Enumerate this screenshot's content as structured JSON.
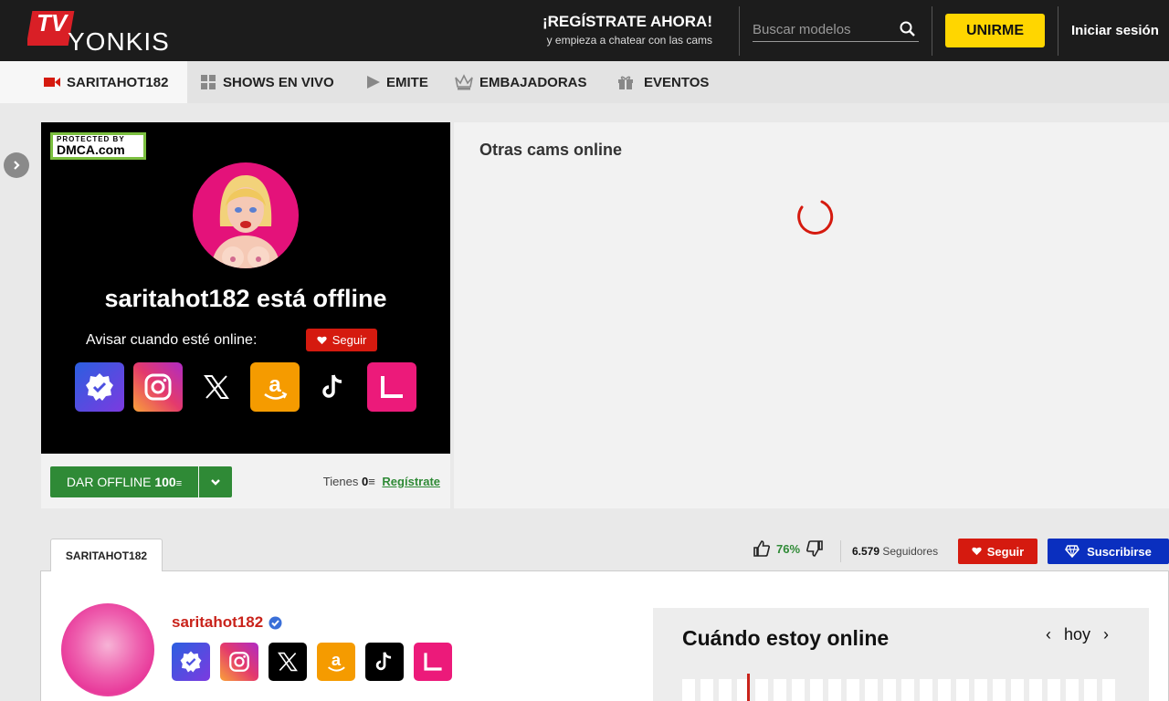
{
  "header": {
    "logo_text": "YONKIS TV",
    "logo_badge": "TV",
    "promo_title": "¡REGÍSTRATE AHORA!",
    "promo_sub": "y empieza a chatear con las cams",
    "search_placeholder": "Buscar modelos",
    "join_label": "UNIRME",
    "login_label": "Iniciar sesión"
  },
  "tabs": [
    {
      "label": "SARITAHOT182",
      "icon": "video-camera-icon"
    },
    {
      "label": "SHOWS EN VIVO",
      "icon": "grid-icon"
    },
    {
      "label": "EMITE",
      "icon": "play-icon"
    },
    {
      "label": "EMBAJADORAS",
      "icon": "crown-icon"
    },
    {
      "label": "EVENTOS",
      "icon": "gift-icon"
    }
  ],
  "player": {
    "dmca_top": "PROTECTED BY",
    "dmca_bottom": "DMCA.com",
    "offline_title": "saritahot182 está offline",
    "notify_label": "Avisar cuando esté online:",
    "follow_label": "Seguir",
    "social": [
      "verified-icon",
      "instagram-icon",
      "x-icon",
      "amazon-icon",
      "tiktok-icon",
      "linktree-icon"
    ]
  },
  "tip": {
    "label": "DAR OFFLINE",
    "amount": "100",
    "balance_label": "Tienes",
    "balance": "0",
    "register_link": "Regístrate"
  },
  "others": {
    "title": "Otras cams online"
  },
  "profile": {
    "tab_label": "SARITAHOT182",
    "rating": "76%",
    "followers_count": "6.579",
    "followers_label": "Seguidores",
    "follow_label": "Seguir",
    "subscribe_label": "Suscribirse",
    "username": "saritahot182",
    "schedule_title": "Cuándo estoy online",
    "schedule_day": "hoy"
  },
  "colors": {
    "accent_red": "#d51a0f",
    "accent_green": "#2f8a36",
    "accent_yellow": "#ffd600",
    "accent_blue": "#0a2fbf"
  }
}
